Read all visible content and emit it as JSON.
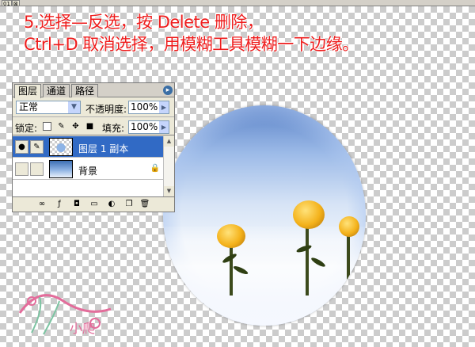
{
  "window": {
    "tab_number": "01",
    "tab_close": "⊠"
  },
  "caption": {
    "line1": "5.选择—反选，按 Delete 删除，",
    "line2": "Ctrl+D 取消选择，用模糊工具模糊一下边缘。"
  },
  "layers_panel": {
    "tabs": [
      "图层",
      "通道",
      "路径"
    ],
    "menu_arrow": "▸",
    "blend_mode": "正常",
    "opacity_label": "不透明度:",
    "opacity_value": "100%",
    "lock_label": "锁定:",
    "fill_label": "填充:",
    "fill_value": "100%",
    "layers": [
      {
        "name": "图层 1 副本",
        "selected": true,
        "visible": true
      },
      {
        "name": "背景",
        "selected": false,
        "visible": false,
        "locked": true
      }
    ],
    "bottom_icons": [
      "link-icon",
      "fx-icon",
      "mask-icon",
      "folder-icon",
      "adjustment-icon",
      "new-layer-icon",
      "trash-icon"
    ]
  },
  "watermark": {
    "text": "小爬"
  },
  "colors": {
    "caption": "#ee1c1c",
    "selection": "#316ac5",
    "panel_bg": "#ece9d8"
  }
}
